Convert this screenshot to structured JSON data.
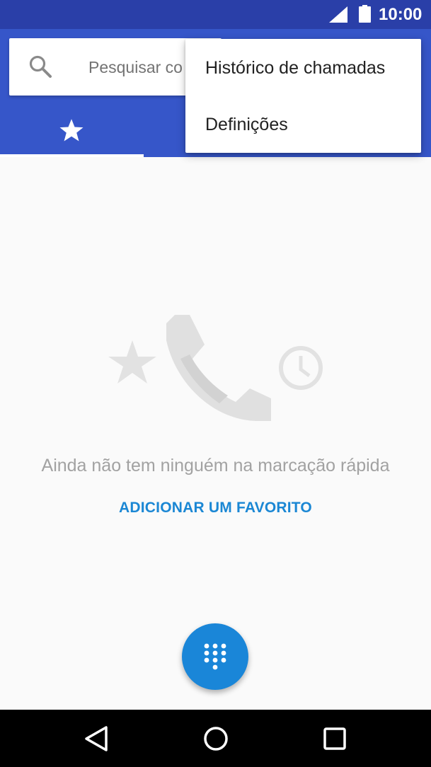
{
  "status_bar": {
    "time": "10:00",
    "icons": [
      "signal-icon",
      "battery-icon"
    ]
  },
  "search": {
    "placeholder": "Pesquisar co",
    "icon": "search-icon"
  },
  "tabs": [
    {
      "icon": "star-icon",
      "selected": true
    }
  ],
  "overflow_menu": {
    "items": [
      {
        "label": "Histórico de chamadas"
      },
      {
        "label": "Definições"
      }
    ]
  },
  "empty_state": {
    "illustration_icons": [
      "star-icon",
      "phone-icon",
      "clock-icon"
    ],
    "message": "Ainda não tem ninguém na marcação rápida",
    "action_label": "ADICIONAR UM FAVORITO"
  },
  "fab": {
    "icon": "dialpad-icon"
  },
  "nav_bar": {
    "icons": [
      "back-icon",
      "home-icon",
      "recents-icon"
    ]
  },
  "colors": {
    "status_bar": "#2a3fa8",
    "app_bar": "#3656c9",
    "accent": "#1a86d8",
    "background": "#fafafa",
    "empty_text": "#a2a2a2"
  }
}
